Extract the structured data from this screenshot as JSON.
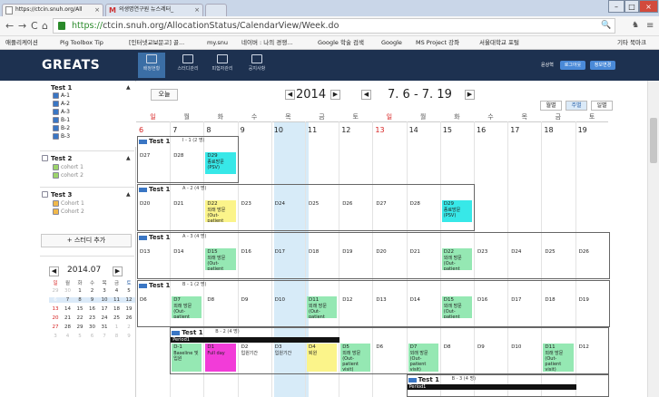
{
  "browser": {
    "tabs": [
      {
        "label": "https://ctcin.snuh.org/All"
      },
      {
        "label": "의생명연구원 뉴스레터_"
      }
    ],
    "tab_close": "×",
    "window_buttons": {
      "minimize": "–",
      "maximize": "□",
      "close": "×"
    },
    "nav": {
      "back": "←",
      "forward": "→",
      "reload": "C",
      "home": "⌂"
    },
    "url_scheme": "https://",
    "url_rest": "ctcin.snuh.org/AllocationStatus/CalendarView/Week.do",
    "toolbar_icons": {
      "search": "🔍",
      "star": "☆",
      "ext": "♞",
      "menu": "≡"
    },
    "bookmarks": [
      "애플리케이션",
      "Pig Toolbox Tip",
      "[인터넷교보문고] 골...",
      "my.snu",
      "네이버 : 나의 경쟁...",
      "Google 학술 검색",
      "Google",
      "MS Project 강좌",
      "서울대학교 포털"
    ],
    "other_bookmarks": "기타 북마크"
  },
  "app": {
    "logo": "GREATS",
    "nav": [
      {
        "label": "배정현황"
      },
      {
        "label": "스터디관리"
      },
      {
        "label": "피험자관리"
      },
      {
        "label": "공지사항"
      }
    ],
    "user": "윤상혁",
    "logout": "로그아웃",
    "edit_info": "정보변경"
  },
  "sidebar": {
    "groups": [
      {
        "title": "Test 1",
        "items": [
          "A-1",
          "A-2",
          "A-3",
          "B-1",
          "B-2",
          "B-3"
        ]
      },
      {
        "title": "Test 2",
        "items": [
          "cohort 1",
          "cohort 2"
        ]
      },
      {
        "title": "Test 3",
        "items": [
          "Cohort 1",
          "Cohort 2"
        ]
      }
    ],
    "collapse_caret": "▲",
    "add_study": "+ 스터디 추가",
    "mini_cal": {
      "title": "2014.07",
      "prev": "◀",
      "next": "▶",
      "weekdays": [
        "일",
        "월",
        "화",
        "수",
        "목",
        "금",
        "토"
      ],
      "weeks": [
        [
          "29",
          "30",
          "1",
          "2",
          "3",
          "4",
          "5"
        ],
        [
          "6",
          "7",
          "8",
          "9",
          "10",
          "11",
          "12"
        ],
        [
          "13",
          "14",
          "15",
          "16",
          "17",
          "18",
          "19"
        ],
        [
          "20",
          "21",
          "22",
          "23",
          "24",
          "25",
          "26"
        ],
        [
          "27",
          "28",
          "29",
          "30",
          "31",
          "1",
          "2"
        ],
        [
          "3",
          "4",
          "5",
          "6",
          "7",
          "8",
          "9"
        ]
      ]
    }
  },
  "calendar": {
    "today_btn": "오늘",
    "year": "2014",
    "range": "7. 6 - 7. 19",
    "prev": "◀",
    "next": "▶",
    "views": [
      "월별",
      "주별",
      "일별"
    ],
    "weekdays": [
      "일",
      "월",
      "화",
      "수",
      "목",
      "금",
      "토",
      "일",
      "월",
      "화",
      "수",
      "목",
      "금",
      "토"
    ],
    "dates": [
      "6",
      "7",
      "8",
      "9",
      "10",
      "11",
      "12",
      "13",
      "14",
      "15",
      "16",
      "17",
      "18",
      "19"
    ],
    "blocks": [
      {
        "title": "Test 1",
        "sub": "I - 1 (2 명)",
        "cells": [
          "D27",
          "D28",
          "D29\n종료방문(PSV)"
        ]
      },
      {
        "title": "Test 1",
        "sub": "A - 2 (4 명)",
        "cells": [
          "D20",
          "D21",
          "D22\n외래 방문(Out-patient visit)",
          "D23",
          "D24",
          "D25",
          "D26",
          "D27",
          "D28",
          "D29\n종료방문(PSV)"
        ]
      },
      {
        "title": "Test 1",
        "sub": "A - 3 (4 명)",
        "cells": [
          "D13",
          "D14",
          "D15\n외래 방문(Out-patient visit)",
          "D16",
          "D17",
          "D18",
          "D19",
          "D20",
          "D21",
          "D22\n외래 방문(Out-patient visit)",
          "D23",
          "D24",
          "D25",
          "D26"
        ]
      },
      {
        "title": "Test 1",
        "sub": "B - 1 (2 명)",
        "cells": [
          "D6",
          "D7\n외래 방문(Out-patient visit)",
          "D8",
          "D9",
          "D10",
          "D11\n외래 방문(Out-patient visit)",
          "D12",
          "D13",
          "D14",
          "D15\n외래 방문(Out-patient visit)",
          "D16",
          "D17",
          "D18",
          "D19"
        ]
      },
      {
        "title": "Test 1",
        "sub": "B - 2 (4 명)",
        "period": "Period1",
        "cells": [
          "D-1\nBaseline 및 입원",
          "D1\nFull day",
          "D2\n입원기간",
          "D3\n입원기간",
          "D4\n퇴원",
          "D5\n외래 방문(Out-patient visit)",
          "D6",
          "D7\n외래 방문(Out-patient visit)",
          "D8",
          "D9",
          "D10",
          "D11\n외래 방문(Out-patient visit)",
          "D12"
        ]
      },
      {
        "title": "Test 1",
        "sub": "B - 3 (4 명)",
        "period": "Period1",
        "cells": []
      }
    ]
  },
  "colors": {
    "header_bg": "#1d3150",
    "today_col": "#d7ebf8",
    "sunday": "#d62020",
    "highlight_yellow": "#fbf48a",
    "cyan": "#37e8e8",
    "green": "#95e8b3",
    "magenta": "#f23cd8"
  }
}
